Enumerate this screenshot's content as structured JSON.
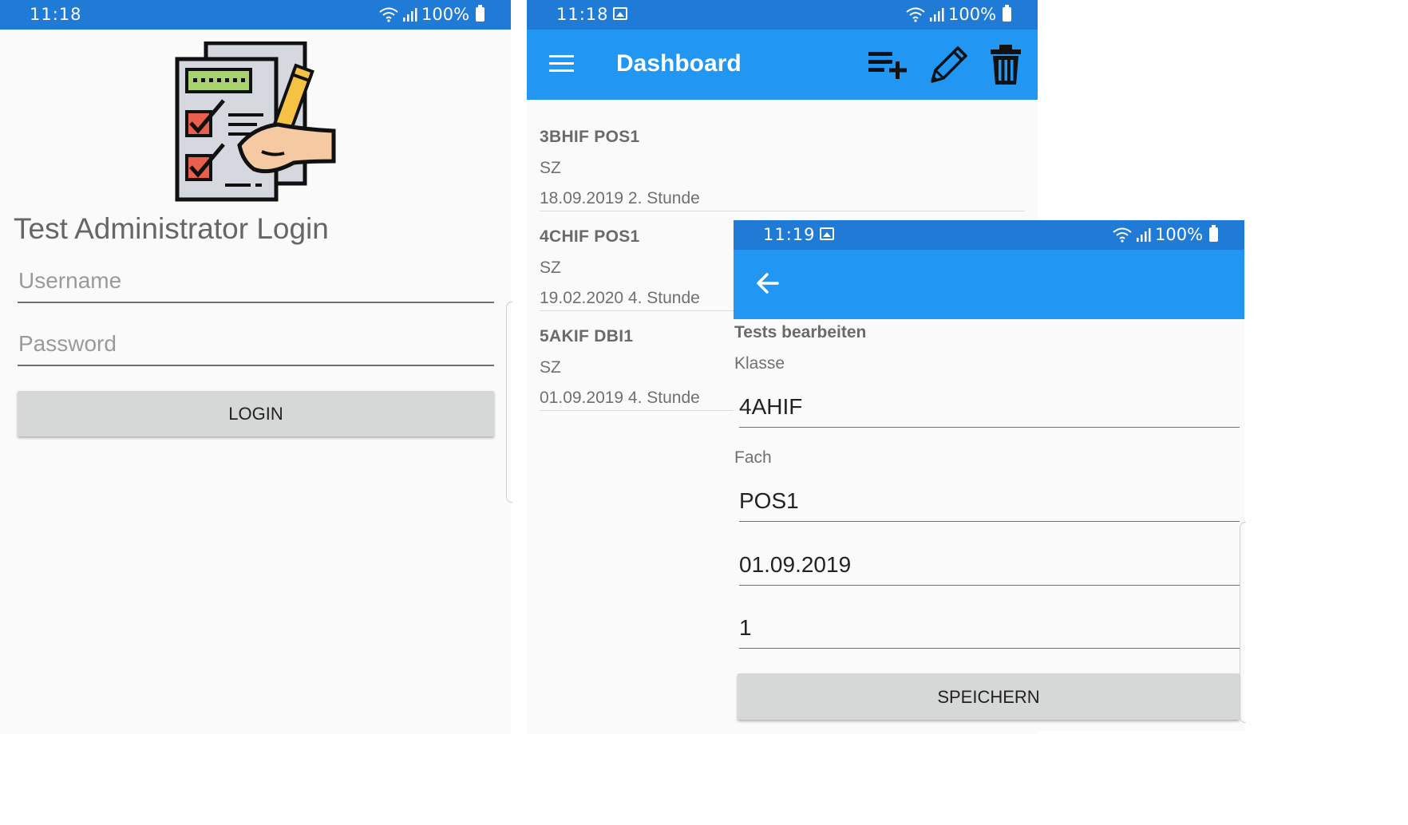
{
  "login_screen": {
    "status": {
      "time": "11:18",
      "battery": "100%"
    },
    "title": "Test Administrator Login",
    "username_placeholder": "Username",
    "password_placeholder": "Password",
    "login_button": "LOGIN"
  },
  "dashboard_screen": {
    "status": {
      "time": "11:18",
      "battery": "100%"
    },
    "title": "Dashboard",
    "tests": [
      {
        "header": "3BHIF  POS1",
        "teacher": "SZ",
        "date": "18.09.2019  2. Stunde"
      },
      {
        "header": "4CHIF  POS1",
        "teacher": "SZ",
        "date": "19.02.2020  4. Stunde"
      },
      {
        "header": "5AKIF  DBI1",
        "teacher": "SZ",
        "date": "01.09.2019  4. Stunde"
      }
    ],
    "icons": [
      "menu-icon",
      "playlist-add-icon",
      "pencil-icon",
      "trash-icon"
    ]
  },
  "edit_screen": {
    "status": {
      "time": "11:19",
      "battery": "100%"
    },
    "section_title": "Tests bearbeiten",
    "klasse_label": "Klasse",
    "klasse_value": "4AHIF",
    "fach_label": "Fach",
    "fach_value": "POS1",
    "date_value": "01.09.2019",
    "lesson_value": "1",
    "save_button": "SPEICHERN"
  },
  "colors": {
    "statusbar": "#1f7bd6",
    "appbar": "#2196f3",
    "button": "#d6d7d7",
    "background": "#fafafa"
  }
}
